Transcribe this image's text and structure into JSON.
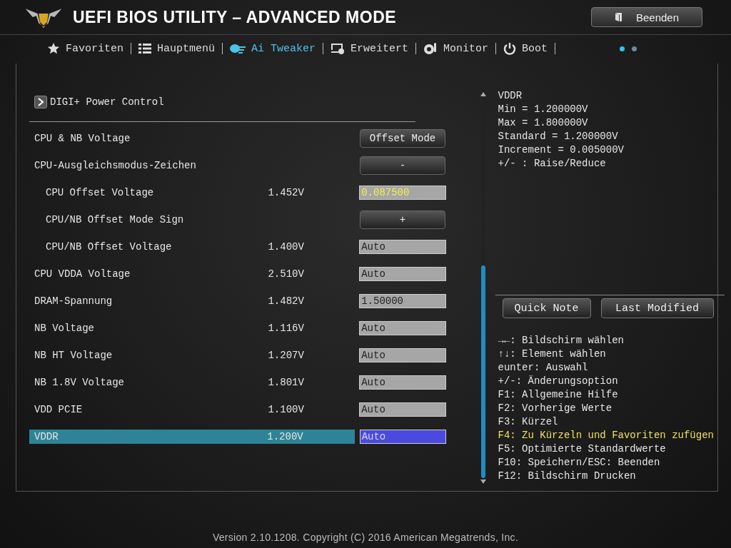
{
  "header": {
    "title": "UEFI BIOS UTILITY – ADVANCED MODE",
    "exit_button": "Beenden"
  },
  "tabs": [
    {
      "label": "Favoriten",
      "kind": "star",
      "selected": false
    },
    {
      "label": "Hauptmenü",
      "kind": "list",
      "selected": false
    },
    {
      "label": "Ai Tweaker",
      "kind": "tweaker",
      "selected": true
    },
    {
      "label": "Erweitert",
      "kind": "advanced",
      "selected": false
    },
    {
      "label": "Monitor",
      "kind": "monitor",
      "selected": false
    },
    {
      "label": "Boot",
      "kind": "power",
      "selected": false
    }
  ],
  "pages": [
    {
      "selected": true
    },
    {
      "selected": false
    }
  ],
  "submenu": "DIGI+ Power Control",
  "settings": [
    {
      "label": "CPU & NB Voltage",
      "kind": "button",
      "value": "Offset Mode",
      "selected": false
    },
    {
      "label": "CPU-Ausgleichsmodus-Zeichen",
      "kind": "button",
      "value": "-",
      "selected": false,
      "children": [
        {
          "label": "CPU Offset Voltage",
          "reading": "1.452V",
          "kind": "field",
          "value": "0.087500",
          "changed": true,
          "selected": false
        },
        {
          "label": "CPU/NB Offset Mode Sign",
          "kind": "button",
          "value": "+",
          "selected": false
        },
        {
          "label": "CPU/NB Offset Voltage",
          "reading": "1.400V",
          "kind": "field",
          "value": "Auto",
          "changed": false,
          "selected": false
        }
      ]
    },
    {
      "label": "CPU VDDA Voltage",
      "reading": "2.510V",
      "kind": "field",
      "value": "Auto",
      "changed": false,
      "selected": false
    },
    {
      "label": "DRAM-Spannung",
      "reading": "1.482V",
      "kind": "field",
      "value": "1.50000",
      "changed": false,
      "selected": false
    },
    {
      "label": "NB Voltage",
      "reading": "1.116V",
      "kind": "field",
      "value": "Auto",
      "changed": false,
      "selected": false
    },
    {
      "label": "NB HT Voltage",
      "reading": "1.207V",
      "kind": "field",
      "value": "Auto",
      "changed": false,
      "selected": false
    },
    {
      "label": "NB 1.8V Voltage",
      "reading": "1.801V",
      "kind": "field",
      "value": "Auto",
      "changed": false,
      "selected": false
    },
    {
      "label": "VDD PCIE",
      "reading": "1.100V",
      "kind": "field",
      "value": "Auto",
      "changed": false,
      "selected": false
    },
    {
      "label": "VDDR",
      "reading": "1.200V",
      "kind": "field",
      "value": "Auto",
      "changed": false,
      "selected": true
    }
  ],
  "help": [
    "VDDR",
    "Min = 1.200000V",
    "Max = 1.800000V",
    "Standard = 1.200000V",
    "Increment = 0.005000V",
    "+/- : Raise/Reduce"
  ],
  "panel_buttons": [
    "Quick Note",
    "Last Modified"
  ],
  "keys": [
    {
      "text": "→←: Bildschirm wählen",
      "highlighted": false
    },
    {
      "text": "↑↓: Element wählen",
      "highlighted": false
    },
    {
      "text": "eunter: Auswahl",
      "highlighted": false
    },
    {
      "text": "+/-: Änderungsoption",
      "highlighted": false
    },
    {
      "text": "F1: Allgemeine Hilfe",
      "highlighted": false
    },
    {
      "text": "F2: Vorherige Werte",
      "highlighted": false
    },
    {
      "text": "F3: Kürzel",
      "highlighted": false
    },
    {
      "text": "F4: Zu Kürzeln und Favoriten zufügen",
      "highlighted": true
    },
    {
      "text": "F5: Optimierte Standardwerte",
      "highlighted": false
    },
    {
      "text": "F10: Speichern/ESC: Beenden",
      "highlighted": false
    },
    {
      "text": "F12: Bildschirm Drucken",
      "highlighted": false
    }
  ],
  "footer": "Version 2.10.1208. Copyright (C) 2016 American Megatrends, Inc."
}
